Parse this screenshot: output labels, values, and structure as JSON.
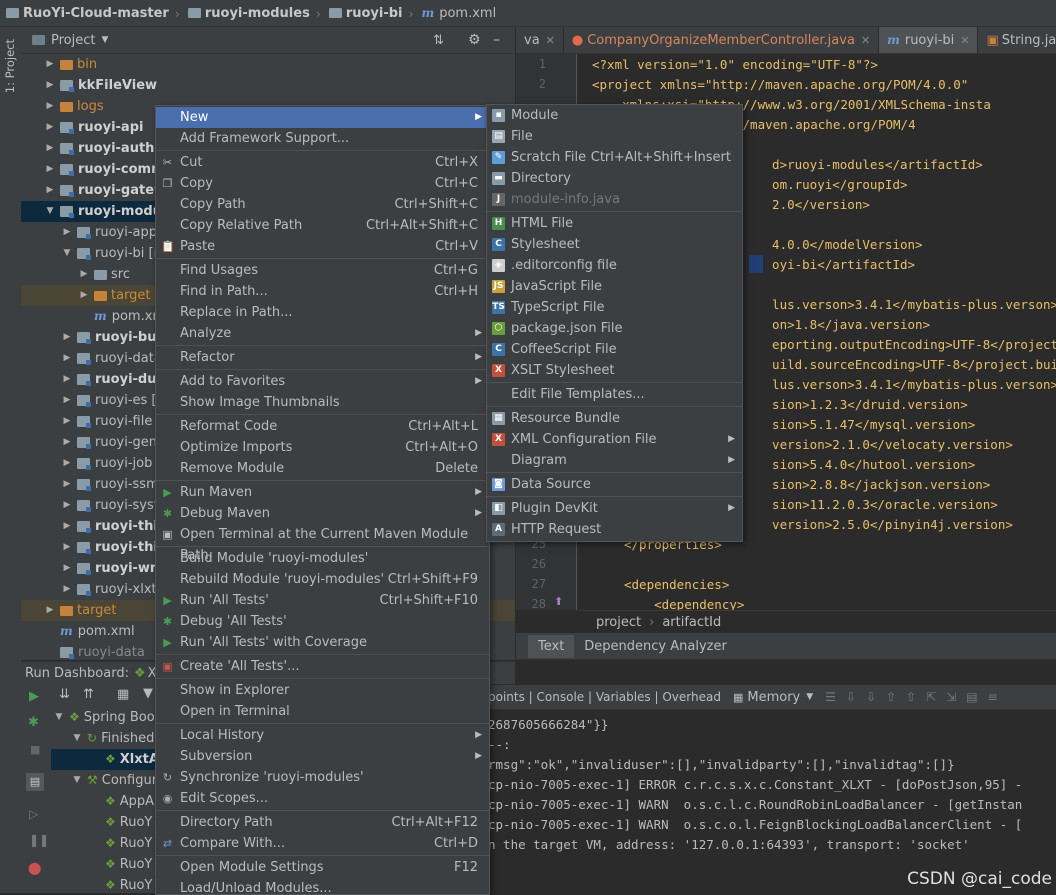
{
  "navbar": {
    "crumbs": [
      "RuoYi-Cloud-master",
      "ruoyi-modules",
      "ruoyi-bi",
      "pom.xml"
    ]
  },
  "stripe": {
    "label": "1: Project"
  },
  "project": {
    "title": "Project",
    "tree": [
      {
        "label": "bin",
        "style": "dim"
      },
      {
        "label": "kkFileView",
        "style": "bold"
      },
      {
        "label": "logs",
        "style": "dim"
      },
      {
        "label": "ruoyi-api",
        "style": "bold"
      },
      {
        "label": "ruoyi-auth",
        "style": "bold"
      },
      {
        "label": "ruoyi-comm",
        "style": "bold"
      },
      {
        "label": "ruoyi-gatew",
        "style": "bold"
      },
      {
        "label": "ruoyi-modul",
        "style": "bold"
      },
      {
        "label": "ruoyi-app",
        "style": "normal"
      },
      {
        "label": "ruoyi-bi [r",
        "style": "normal"
      },
      {
        "label": "src",
        "style": "normal"
      },
      {
        "label": "target",
        "style": "orange"
      },
      {
        "label": "pom.xn",
        "style": "normal"
      },
      {
        "label": "ruoyi-bus",
        "style": "bold"
      },
      {
        "label": "ruoyi-data",
        "style": "normal"
      },
      {
        "label": "ruoyi-duil",
        "style": "bold"
      },
      {
        "label": "ruoyi-es [",
        "style": "normal"
      },
      {
        "label": "ruoyi-file [",
        "style": "normal"
      },
      {
        "label": "ruoyi-gen",
        "style": "normal"
      },
      {
        "label": "ruoyi-job [",
        "style": "normal"
      },
      {
        "label": "ruoyi-ssm",
        "style": "normal"
      },
      {
        "label": "ruoyi-syste",
        "style": "normal"
      },
      {
        "label": "ruoyi-thir",
        "style": "bold"
      },
      {
        "label": "ruoyi-thir",
        "style": "bold"
      },
      {
        "label": "ruoyi-wm",
        "style": "bold"
      },
      {
        "label": "ruoyi-xlxt [",
        "style": "normal"
      },
      {
        "label": "target",
        "style": "orange"
      },
      {
        "label": "pom.xml",
        "style": "normal"
      },
      {
        "label": "ruoyi-data",
        "style": "dim"
      }
    ]
  },
  "tabs": [
    {
      "label": "va"
    },
    {
      "label": "CompanyOrganizeMemberController.java"
    },
    {
      "label": "ruoyi-bi"
    },
    {
      "label": "String.java"
    }
  ],
  "editor": {
    "lines": [
      {
        "n": "1",
        "text": "<?xml version=\"1.0\" encoding=\"UTF-8\"?>"
      },
      {
        "n": "2",
        "text": "<project xmlns=\"http://maven.apache.org/POM/4.0.0\""
      },
      {
        "n": "",
        "text": "         xmlns:xsi=\"http://www.w3.org/2001/XMLSchema-insta"
      },
      {
        "n": "",
        "text": "         xsi:schemaLocation=\"http://maven.apache.org/POM/4"
      },
      {
        "n": "",
        "text": ""
      },
      {
        "n": "",
        "text": "    <artifactId>ruoyi-modules</artifactId>"
      },
      {
        "n": "",
        "text": "        <groupId>com.ruoyi</groupId>"
      },
      {
        "n": "",
        "text": "        <version>2.2.0</version>"
      },
      {
        "n": "",
        "text": ""
      },
      {
        "n": "",
        "text": "    <modelVersion>4.0.0</modelVersion>"
      },
      {
        "n": "",
        "text": "    <artifactId>ruoyi-bi</artifactId>"
      },
      {
        "n": "",
        "text": ""
      },
      {
        "n": "",
        "text": "        <mybatis-plus.verson>3.4.1</mybatis-plus.verson>"
      },
      {
        "n": "",
        "text": "        <java.version>1.8</java.version>"
      },
      {
        "n": "",
        "text": "        <project.reporting.outputEncoding>UTF-8</project.r"
      },
      {
        "n": "",
        "text": "        <project.build.sourceEncoding>UTF-8</project.build"
      },
      {
        "n": "",
        "text": "        <mybatis-plus.verson>3.4.1</mybatis-plus.verson>"
      },
      {
        "n": "",
        "text": "        <druid.version>1.2.3</druid.version>"
      },
      {
        "n": "",
        "text": "        <mysql.version>5.1.47</mysql.version>"
      },
      {
        "n": "",
        "text": "        <velocaty.version>2.1.0</velocaty.version>"
      },
      {
        "n": "",
        "text": "        <hutool.version>5.4.0</hutool.version>"
      },
      {
        "n": "",
        "text": "        <jackjson.version>2.8.8</jackjson.version>"
      },
      {
        "n": "",
        "text": "        <oracle.version>11.2.0.3</oracle.version>"
      },
      {
        "n": "",
        "text": "        <pinyin4j.version>2.5.0</pinyin4j.version>"
      },
      {
        "n": "25",
        "text": "    </properties>"
      },
      {
        "n": "26",
        "text": ""
      },
      {
        "n": "27",
        "text": "    <dependencies>"
      },
      {
        "n": "28",
        "text": "        <dependency>"
      }
    ],
    "visible_fragments": [
      {
        "row": 0,
        "html_text": "<?xml version=\"1.0\" encoding=\"UTF-8\"?>"
      },
      {
        "row": 1,
        "html_text": "<project xmlns=\"http://maven.apache.org/POM/4.0.0\""
      },
      {
        "row": 2,
        "html_text": "    xmlns:xsi=\"http://www.w3.org/2001/XMLSchema-insta"
      },
      {
        "row": 3,
        "html_text": "   aLocation=\"http://maven.apache.org/POM/4"
      },
      {
        "row": 5,
        "html_text": "  d>ruoyi-modules</artifactId>"
      },
      {
        "row": 6,
        "html_text": "  om.ruoyi</groupId>"
      },
      {
        "row": 7,
        "html_text": "  2.0</version>"
      },
      {
        "row": 9,
        "html_text": "  4.0.0</modelVersion>"
      },
      {
        "row": 10,
        "html_text": "  oyi-bi</artifactId>"
      },
      {
        "row": 12,
        "html_text": "  lus.verson>3.4.1</mybatis-plus.verson>"
      },
      {
        "row": 13,
        "html_text": "  on>1.8</java.version>"
      },
      {
        "row": 14,
        "html_text": "  eporting.outputEncoding>UTF-8</project.r"
      },
      {
        "row": 15,
        "html_text": "  uild.sourceEncoding>UTF-8</project.build"
      },
      {
        "row": 16,
        "html_text": "  lus.verson>3.4.1</mybatis-plus.verson>"
      },
      {
        "row": 17,
        "html_text": "  sion>1.2.3</druid.version>"
      },
      {
        "row": 18,
        "html_text": "  sion>5.1.47</mysql.version>"
      },
      {
        "row": 19,
        "html_text": "  version>2.1.0</velocaty.version>"
      },
      {
        "row": 20,
        "html_text": "  sion>5.4.0</hutool.version>"
      },
      {
        "row": 21,
        "html_text": "  sion>2.8.8</jackjson.version>"
      },
      {
        "row": 22,
        "html_text": "  sion>11.2.0.3</oracle.version>"
      },
      {
        "row": 23,
        "html_text": "  version>2.5.0</pinyin4j.version>"
      },
      {
        "row": 24,
        "html_text": "</properties>"
      },
      {
        "row": 26,
        "html_text": "<dependencies>"
      },
      {
        "row": 27,
        "html_text": "    <dependency>"
      }
    ]
  },
  "breadcrumb": [
    "project",
    "artifactId"
  ],
  "bottom_tabs": [
    "Text",
    "Dependency Analyzer"
  ],
  "run": {
    "title": "Run Dashboard:",
    "title_suffix": "Xl",
    "tree": [
      {
        "label": "Spring Boo"
      },
      {
        "label": "Finished"
      },
      {
        "label": "XlxtA"
      },
      {
        "label": "Configur"
      },
      {
        "label": "AppA"
      },
      {
        "label": "RuoY"
      },
      {
        "label": "RuoY"
      },
      {
        "label": "RuoY"
      },
      {
        "label": "RuoY"
      }
    ]
  },
  "console": {
    "header": "points | Console | Variables | Overhead",
    "memory": "Memory",
    "lines": [
      "2687605666284\"}}",
      "--:",
      "rmsg\":\"ok\",\"invaliduser\":[],\"invalidparty\":[],\"invalidtag\":[]}",
      "cp-nio-7005-exec-1] ERROR c.r.c.s.x.c.Constant_XLXT - [doPostJson,95] -",
      "cp-nio-7005-exec-1] WARN  o.s.c.l.c.RoundRobinLoadBalancer - [getInstan",
      "cp-nio-7005-exec-1] WARN  o.s.c.o.l.FeignBlockingLoadBalancerClient - [",
      "n the target VM, address: '127.0.0.1:64393', transport: 'socket'"
    ]
  },
  "context_menu": {
    "items": [
      {
        "label": "New",
        "shortcut": "",
        "submenu": true
      },
      {
        "label": "Add Framework Support...",
        "shortcut": ""
      },
      {
        "sep": true
      },
      {
        "label": "Cut",
        "shortcut": "Ctrl+X",
        "icon": "scissors-icon"
      },
      {
        "label": "Copy",
        "shortcut": "Ctrl+C",
        "icon": "copy-icon"
      },
      {
        "label": "Copy Path",
        "shortcut": "Ctrl+Shift+C"
      },
      {
        "label": "Copy Relative Path",
        "shortcut": "Ctrl+Alt+Shift+C"
      },
      {
        "label": "Paste",
        "shortcut": "Ctrl+V",
        "icon": "paste-icon"
      },
      {
        "sep": true
      },
      {
        "label": "Find Usages",
        "shortcut": "Ctrl+G"
      },
      {
        "label": "Find in Path...",
        "shortcut": "Ctrl+H"
      },
      {
        "label": "Replace in Path...",
        "shortcut": ""
      },
      {
        "label": "Analyze",
        "shortcut": "",
        "submenu": true
      },
      {
        "sep": true
      },
      {
        "label": "Refactor",
        "shortcut": "",
        "submenu": true
      },
      {
        "sep": true
      },
      {
        "label": "Add to Favorites",
        "shortcut": "",
        "submenu": true
      },
      {
        "label": "Show Image Thumbnails",
        "shortcut": ""
      },
      {
        "sep": true
      },
      {
        "label": "Reformat Code",
        "shortcut": "Ctrl+Alt+L"
      },
      {
        "label": "Optimize Imports",
        "shortcut": "Ctrl+Alt+O"
      },
      {
        "label": "Remove Module",
        "shortcut": "Delete"
      },
      {
        "sep": true
      },
      {
        "label": "Run Maven",
        "shortcut": "",
        "submenu": true,
        "icon": "maven-run-icon"
      },
      {
        "label": "Debug Maven",
        "shortcut": "",
        "submenu": true,
        "icon": "maven-debug-icon"
      },
      {
        "label": "Open Terminal at the Current Maven Module Path",
        "shortcut": "",
        "icon": "terminal-icon"
      },
      {
        "sep": true
      },
      {
        "label": "Build Module 'ruoyi-modules'",
        "shortcut": ""
      },
      {
        "label": "Rebuild Module 'ruoyi-modules'",
        "shortcut": "Ctrl+Shift+F9"
      },
      {
        "label": "Run 'All Tests'",
        "shortcut": "Ctrl+Shift+F10",
        "icon": "run-icon"
      },
      {
        "label": "Debug 'All Tests'",
        "shortcut": "",
        "icon": "debug-icon"
      },
      {
        "label": "Run 'All Tests' with Coverage",
        "shortcut": "",
        "icon": "coverage-icon"
      },
      {
        "sep": true
      },
      {
        "label": "Create 'All Tests'...",
        "shortcut": "",
        "icon": "create-test-icon"
      },
      {
        "sep": true
      },
      {
        "label": "Show in Explorer",
        "shortcut": ""
      },
      {
        "label": "Open in Terminal",
        "shortcut": ""
      },
      {
        "sep": true
      },
      {
        "label": "Local History",
        "shortcut": "",
        "submenu": true
      },
      {
        "label": "Subversion",
        "shortcut": "",
        "submenu": true
      },
      {
        "label": "Synchronize 'ruoyi-modules'",
        "shortcut": "",
        "icon": "sync-icon"
      },
      {
        "label": "Edit Scopes...",
        "shortcut": "",
        "icon": "scope-icon"
      },
      {
        "sep": true
      },
      {
        "label": "Directory Path",
        "shortcut": "Ctrl+Alt+F12"
      },
      {
        "label": "Compare With...",
        "shortcut": "Ctrl+D",
        "icon": "compare-icon"
      },
      {
        "sep": true
      },
      {
        "label": "Open Module Settings",
        "shortcut": "F12"
      },
      {
        "label": "Load/Unload Modules...",
        "shortcut": ""
      }
    ]
  },
  "submenu": {
    "items": [
      {
        "label": "Module",
        "icon": "module-icon",
        "color": "#8a9ba8"
      },
      {
        "label": "File",
        "icon": "file-icon",
        "color": "#9aa7b0"
      },
      {
        "label": "Scratch File",
        "shortcut": "Ctrl+Alt+Shift+Insert",
        "icon": "scratch-icon",
        "color": "#5e9ed6"
      },
      {
        "label": "Directory",
        "icon": "folder-icon",
        "color": "#8a9ba8"
      },
      {
        "label": "module-info.java",
        "icon": "java-icon",
        "color": "#666666",
        "disabled": true
      },
      {
        "sep": true
      },
      {
        "label": "HTML File",
        "icon": "html-icon",
        "color": "#4a8c4e"
      },
      {
        "label": "Stylesheet",
        "icon": "css-icon",
        "color": "#3d74a8"
      },
      {
        "label": ".editorconfig file",
        "icon": "editorconfig-icon",
        "color": "#cccccc"
      },
      {
        "label": "JavaScript File",
        "icon": "js-icon",
        "color": "#c9a13a"
      },
      {
        "label": "TypeScript File",
        "icon": "ts-icon",
        "color": "#3d74a8"
      },
      {
        "label": "package.json File",
        "icon": "nodejs-icon",
        "color": "#6a9e3a"
      },
      {
        "label": "CoffeeScript File",
        "icon": "coffee-icon",
        "color": "#3d74a8"
      },
      {
        "label": "XSLT Stylesheet",
        "icon": "xslt-icon",
        "color": "#c2503a"
      },
      {
        "sep": true
      },
      {
        "label": "Edit File Templates..."
      },
      {
        "sep": true
      },
      {
        "label": "Resource Bundle",
        "icon": "bundle-icon",
        "color": "#8a9ba8"
      },
      {
        "label": "XML Configuration File",
        "icon": "xml-icon",
        "color": "#c2503a",
        "submenu": true
      },
      {
        "label": "Diagram",
        "submenu": true
      },
      {
        "sep": true
      },
      {
        "label": "Data Source",
        "icon": "database-icon",
        "color": "#6b9bd2"
      },
      {
        "sep": true
      },
      {
        "label": "Plugin DevKit",
        "icon": "plugin-icon",
        "color": "#8a9ba8",
        "submenu": true
      },
      {
        "label": "HTTP Request",
        "icon": "api-icon",
        "color": "#5b6b7a"
      }
    ]
  },
  "watermark": "CSDN @cai_code",
  "colors": {
    "highlight": "#4b6eaf",
    "panel": "#3c3f41",
    "editor_bg": "#2b2b2b",
    "selected_row": "#0d293e"
  }
}
